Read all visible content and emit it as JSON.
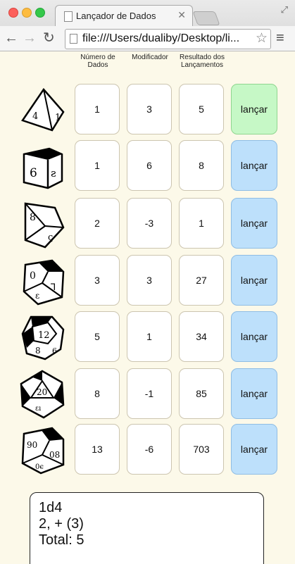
{
  "tab": {
    "title": "Lançador de Dados"
  },
  "address_bar": {
    "url": "file:///Users/dualiby/Desktop/li..."
  },
  "headers": {
    "num_dice": "Número de Dados",
    "modifier": "Modificador",
    "results": "Resultado dos Lançamentos"
  },
  "rows": [
    {
      "die": "d4-icon",
      "num_dice": "1",
      "modifier": "3",
      "result": "5",
      "button": "lançar"
    },
    {
      "die": "d6-icon",
      "num_dice": "1",
      "modifier": "6",
      "result": "8",
      "button": "lançar"
    },
    {
      "die": "d8-icon",
      "num_dice": "2",
      "modifier": "-3",
      "result": "1",
      "button": "lançar"
    },
    {
      "die": "d10-icon",
      "num_dice": "3",
      "modifier": "3",
      "result": "27",
      "button": "lançar"
    },
    {
      "die": "d12-icon",
      "num_dice": "5",
      "modifier": "1",
      "result": "34",
      "button": "lançar"
    },
    {
      "die": "d20-icon",
      "num_dice": "8",
      "modifier": "-1",
      "result": "85",
      "button": "lançar"
    },
    {
      "die": "d100-icon",
      "num_dice": "13",
      "modifier": "-6",
      "result": "703",
      "button": "lançar"
    }
  ],
  "result_panel": {
    "line1": "1d4",
    "line2": "2,  + (3)",
    "line3": "Total: 5"
  },
  "colors": {
    "page_background": "#fcf9e9",
    "roll_button": "#bde0fb",
    "roll_button_highlight": "#c6f8c6"
  }
}
